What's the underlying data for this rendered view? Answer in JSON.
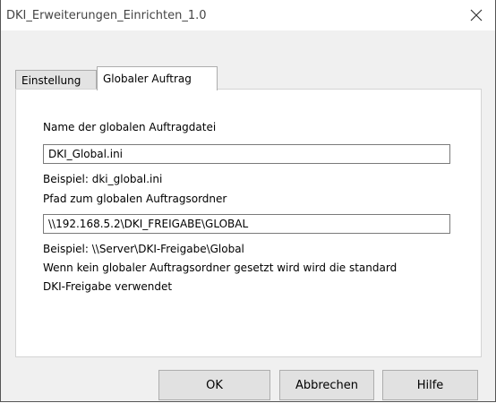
{
  "window": {
    "title": "DKI_Erweiterungen_Einrichten_1.0"
  },
  "tabs": [
    {
      "label": "Einstellung"
    },
    {
      "label": "Globaler Auftrag"
    }
  ],
  "form": {
    "file_name_label": "Name der globalen Auftragdatei",
    "file_name_value": "DKI_Global.ini",
    "file_name_example": "Beispiel: dki_global.ini",
    "folder_label": "Pfad zum globalen Auftragsordner",
    "folder_value": "\\\\192.168.5.2\\DKI_FREIGABE\\GLOBAL",
    "folder_example": "Beispiel: \\\\Server\\DKI-Freigabe\\Global",
    "note_line1": "Wenn kein globaler Auftragsordner gesetzt wird wird die standard",
    "note_line2": "DKI-Freigabe verwendet"
  },
  "buttons": {
    "ok": "OK",
    "cancel": "Abbrechen",
    "help": "Hilfe"
  }
}
